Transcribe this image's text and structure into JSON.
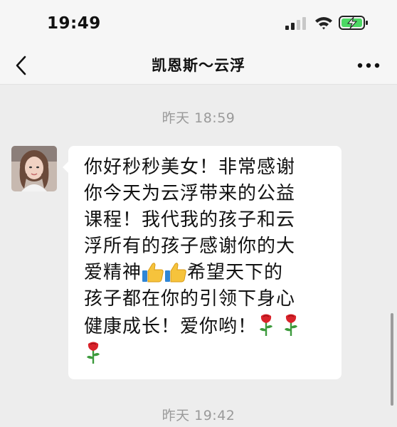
{
  "status_bar": {
    "time": "19:49"
  },
  "nav": {
    "title": "凯恩斯～云浮",
    "back_icon": "chevron-left-icon",
    "more_icon": "more-dots-icon"
  },
  "chat": {
    "timestamp_1": "昨天 18:59",
    "timestamp_2": "昨天 19:42",
    "message": {
      "line_1": "你好秒秒美女！非常感谢",
      "line_2": "你今天为云浮带来的公益",
      "line_3": "课程！我代我的孩子和云",
      "line_4": "浮所有的孩子感谢你的大",
      "line_5a": "爱精神",
      "line_5b": "希望天下的",
      "line_6": "孩子都在你的引领下身心",
      "line_7": "健康成长！爱你哟！"
    }
  },
  "colors": {
    "bg": "#ededed",
    "bubble": "#ffffff",
    "timestamp": "#9a9a9a",
    "battery": "#4cd964"
  }
}
